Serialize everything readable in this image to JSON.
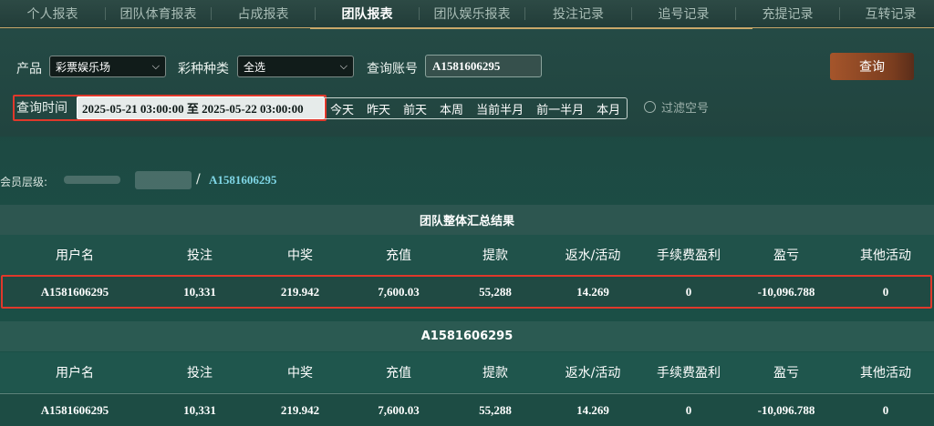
{
  "tabs": [
    {
      "label": "个人报表",
      "active": false
    },
    {
      "label": "团队体育报表",
      "active": false
    },
    {
      "label": "占成报表",
      "active": false
    },
    {
      "label": "团队报表",
      "active": true
    },
    {
      "label": "团队娱乐报表",
      "active": false
    },
    {
      "label": "投注记录",
      "active": false
    },
    {
      "label": "追号记录",
      "active": false
    },
    {
      "label": "充提记录",
      "active": false
    },
    {
      "label": "互转记录",
      "active": false
    }
  ],
  "filters": {
    "product_label": "产品",
    "product_value": "彩票娱乐场",
    "game_type_label": "彩种种类",
    "game_type_value": "全选",
    "account_label": "查询账号",
    "account_value": "A1581606295",
    "query_button": "查询",
    "time_label": "查询时间",
    "time_value": "2025-05-21 03:00:00 至 2025-05-22 03:00:00",
    "quick_ranges": [
      "今天",
      "昨天",
      "前天",
      "本周",
      "当前半月",
      "前一半月",
      "本月"
    ],
    "filter_empty_label": "过滤空号"
  },
  "hierarchy": {
    "label": "会员层级:",
    "separator": "/",
    "account": "A1581606295"
  },
  "columns": [
    "用户名",
    "投注",
    "中奖",
    "充值",
    "提款",
    "返水/活动",
    "手续费盈利",
    "盈亏",
    "其他活动"
  ],
  "summary": {
    "title": "团队整体汇总结果",
    "row": [
      "A1581606295",
      "10,331",
      "219.942",
      "7,600.03",
      "55,288",
      "14.269",
      "0",
      "-10,096.788",
      "0"
    ]
  },
  "detail": {
    "title": "A1581606295",
    "row": [
      "A1581606295",
      "10,331",
      "219.942",
      "7,600.03",
      "55,288",
      "14.269",
      "0",
      "-10,096.788",
      "0"
    ]
  },
  "colors": {
    "highlight": "#e0382b",
    "accent_gold": "#c9a86a",
    "query_button": "#a5552b",
    "link_cyan": "#7fd6e6"
  }
}
